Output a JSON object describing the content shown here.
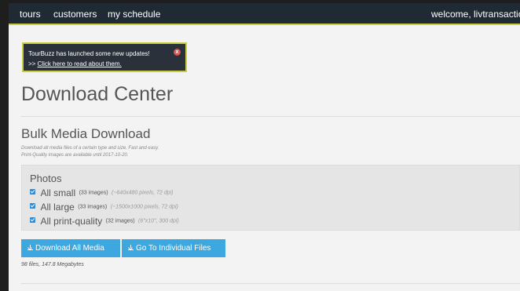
{
  "nav": {
    "tours": "tours",
    "customers": "customers",
    "schedule": "my schedule",
    "welcome": "welcome, livtransactio"
  },
  "notice": {
    "line1": "TourBuzz has launched some new updates!",
    "prefix": ">> ",
    "link": "Click here to read about them.",
    "close": "x"
  },
  "page": {
    "title": "Download Center"
  },
  "bulk": {
    "title": "Bulk Media Download",
    "desc_line1": "Download all media files of a certain type and size. Fast and easy.",
    "desc_line2": "Print-Quality images are available until 2017-10-20."
  },
  "photos": {
    "title": "Photos",
    "options": [
      {
        "label": "All small",
        "count": "(33 images)",
        "detail": "(~640x480 pixels, 72 dpi)"
      },
      {
        "label": "All large",
        "count": "(33 images)",
        "detail": "(~1500x1000 pixels, 72 dpi)"
      },
      {
        "label": "All print-quality",
        "count": "(32 images)",
        "detail": "(6\"x10\", 300 dpi)"
      }
    ]
  },
  "buttons": {
    "download_all": "Download All Media",
    "individual": "Go To Individual Files"
  },
  "files_info": "98 files, 147.8 Megabytes",
  "colors": {
    "topbar": "#1f2a35",
    "accent_line": "#c9cc3f",
    "button": "#3da8e0",
    "checkbox": "#2e8bd6"
  },
  "icons": [
    "close-icon",
    "checkbox-checked-icon",
    "download-icon"
  ]
}
